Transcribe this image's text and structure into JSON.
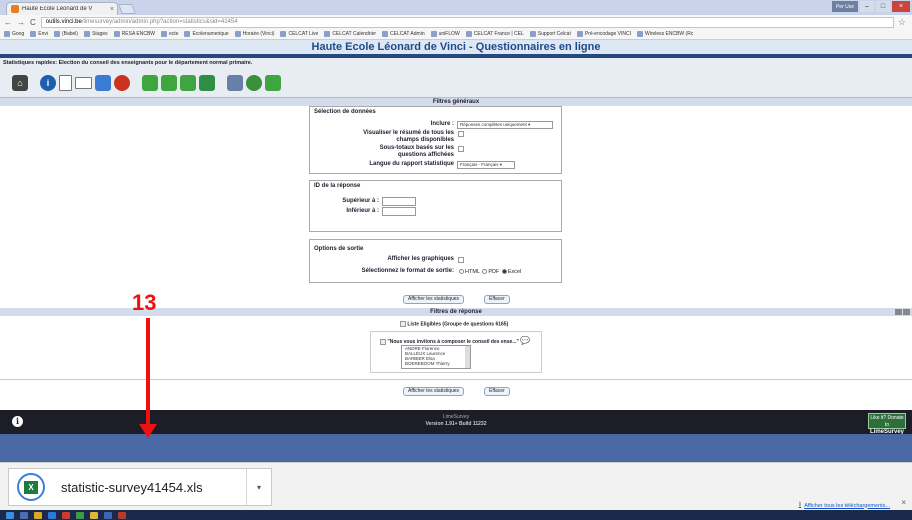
{
  "browser": {
    "tab_title": "Haute Ecole Léonard de V",
    "tab_close": "×",
    "url_host": "outils.vinci.be",
    "url_path": "/limesurvey/admin/admin.php?action=statistics&sid=41454",
    "user_label": "Per Use",
    "win_minimize": "–",
    "win_maximize": "□",
    "win_close": "×",
    "nav_back": "←",
    "nav_forward": "→",
    "nav_reload": "C",
    "star": "☆",
    "bookmarks": [
      "Goog",
      "Envi",
      "(Babel)",
      "Stages",
      "RESA ENCBW",
      "ecte",
      "Ecolenumerique",
      "Horaire (Vinci)",
      "CELCAT Live",
      "CELCAT Calendrier",
      "CELCAT Admin",
      "uniFLOW",
      "CELCAT France | CEL",
      "Support Celcat",
      "Pré-encodage VINCI",
      "Wireless ENCBW (Rc"
    ]
  },
  "site": {
    "title": "Haute Ecole Léonard de Vinci - Questionnaires en ligne",
    "quickstats_label": "Statistiques rapides: Election du conseil des enseignants pour le département normal primaire."
  },
  "filters": {
    "header": "Filtres généraux",
    "data_selection": {
      "legend": "Sélection de données",
      "include_label": "Inclure :",
      "include_value": "Réponses complètes uniquement",
      "summary_label_1": "Visualiser le résumé de tous les",
      "summary_label_2": "champs disponibles",
      "subtotals_label_1": "Sous-totaux basés sur les",
      "subtotals_label_2": "questions affichées",
      "language_label": "Langue du rapport statistique",
      "language_value": "Français - Français"
    },
    "response_id": {
      "legend": "ID de la réponse",
      "greater_label": "Supérieur à :",
      "less_label": "Inférieur à :"
    },
    "output": {
      "legend": "Options de sortie",
      "graphs_label": "Afficher les graphiques",
      "format_label": "Sélectionnez le format de sortie:",
      "formats": [
        "HTML",
        "PDF",
        "Excel"
      ],
      "selected_format": "Excel"
    },
    "show_stats_button": "Afficher les statistiques",
    "clear_button": "Effacer"
  },
  "response_filters": {
    "header": "Filtres de réponse",
    "group_label": "Liste Eligibles (Groupe de questions 6165)",
    "question_label": "\"Nous vous invitons à composer le conseil des ense...\"",
    "candidates": [
      "ANDRE Florence",
      "BALLEUX Laurence",
      "BARBIER Elsa",
      "BOEREBOOM Thierry"
    ]
  },
  "footer": {
    "brand": "LimeSurvey",
    "version": "Version 1.91+ Build 11232",
    "badge_line1": "Like it? Donate to",
    "badge_line2": "LimeSurvey"
  },
  "downloads": {
    "file_name": "statistic-survey41454.xls",
    "file_icon": "X",
    "show_all": "Afficher tous les téléchargements...",
    "close": "×"
  },
  "annotation": {
    "number": "13"
  },
  "colors": {
    "header_dark": "#28497e",
    "site_title": "#1f4a8a",
    "footer_bg": "#1c1d27",
    "blue_band": "#4a69a4",
    "annotation_red": "#e11111"
  }
}
